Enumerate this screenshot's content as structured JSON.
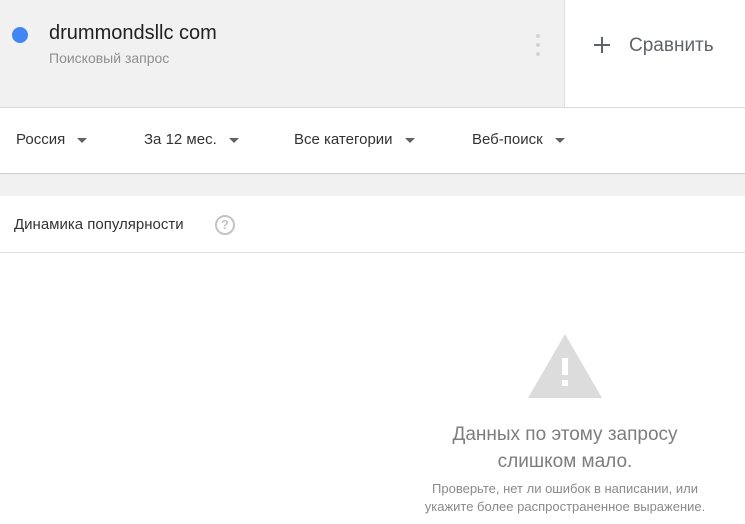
{
  "search_term": {
    "title": "drummondsllc com",
    "subtitle": "Поисковый запрос",
    "dot_color": "#4285f4"
  },
  "compare": {
    "icon": "plus-icon",
    "label": "Сравнить"
  },
  "filters": [
    {
      "label": "Россия",
      "icon": "chevron-down-icon"
    },
    {
      "label": "За 12 мес.",
      "icon": "chevron-down-icon"
    },
    {
      "label": "Все категории",
      "icon": "chevron-down-icon"
    },
    {
      "label": "Веб-поиск",
      "icon": "chevron-down-icon"
    }
  ],
  "interest_card": {
    "title": "Динамика популярности",
    "help_icon": "help-circle-icon",
    "help_glyph": "?",
    "warning_icon": "warning-triangle-icon",
    "message_line1": "Данных по этому запросу",
    "message_line2": "слишком мало.",
    "hint_line1": "Проверьте, нет ли ошибок в написании, или",
    "hint_line2": "укажите более распространенное выражение."
  }
}
